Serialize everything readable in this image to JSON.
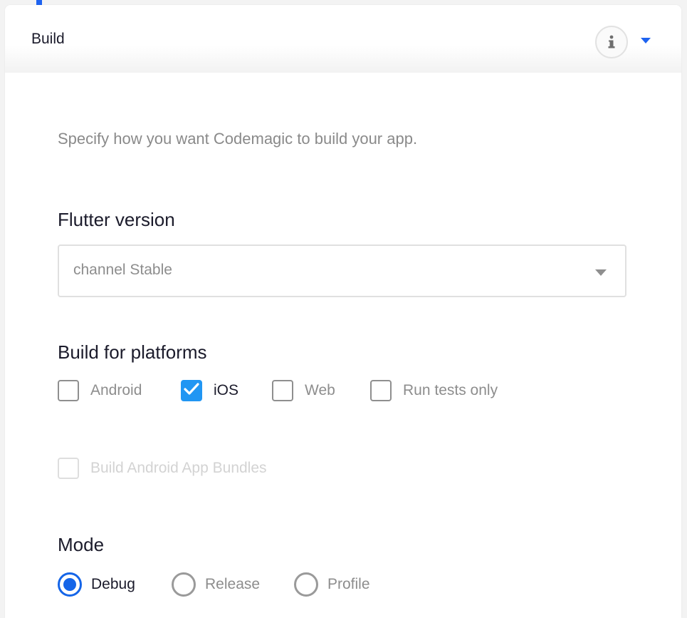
{
  "colors": {
    "accent": "#1e63f0",
    "checkbox_checked": "#2196f3",
    "radio_selected": "#1565e8",
    "text_dark": "#1b1b2b",
    "text_muted": "#8d8d8d"
  },
  "header": {
    "title": "Build",
    "info_icon": "info-icon",
    "toggle_icon": "caret-down-icon"
  },
  "description": "Specify how you want Codemagic to build your app.",
  "flutter_version": {
    "label": "Flutter version",
    "selected": "channel Stable"
  },
  "platforms": {
    "label": "Build for platforms",
    "options": [
      {
        "label": "Android",
        "checked": false
      },
      {
        "label": "iOS",
        "checked": true
      },
      {
        "label": "Web",
        "checked": false
      },
      {
        "label": "Run tests only",
        "checked": false
      }
    ],
    "bundles": {
      "label": "Build Android App Bundles",
      "checked": false,
      "disabled": true
    }
  },
  "mode": {
    "label": "Mode",
    "options": [
      {
        "label": "Debug",
        "selected": true
      },
      {
        "label": "Release",
        "selected": false
      },
      {
        "label": "Profile",
        "selected": false
      }
    ]
  }
}
